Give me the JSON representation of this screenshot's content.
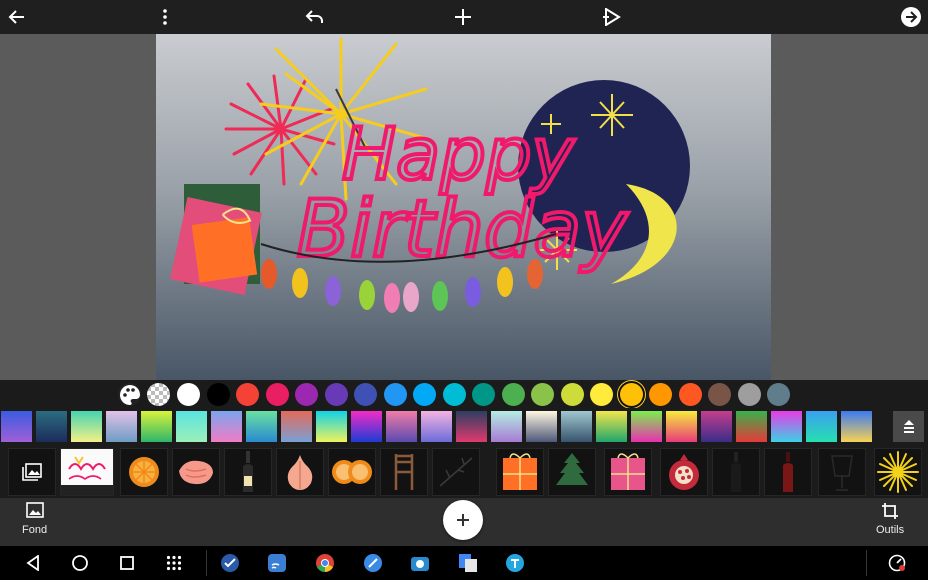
{
  "toolbar": {
    "back_icon": "arrow-left-icon",
    "menu_icon": "more-vertical-icon",
    "undo_icon": "undo-icon",
    "add_icon": "plus-icon",
    "preview_icon": "play-icon",
    "next_icon": "arrow-right-circle-icon"
  },
  "card": {
    "headline_line1": "Happy",
    "headline_line2": "Birthday",
    "accent_color": "#f0196b",
    "moon_color": "#1f2452"
  },
  "palette": {
    "colors": [
      "#ffffff",
      "#000000",
      "#f44336",
      "#e91e63",
      "#9c27b0",
      "#673ab7",
      "#3f51b5",
      "#2196f3",
      "#03a9f4",
      "#00bcd4",
      "#009688",
      "#4caf50",
      "#8bc34a",
      "#cddc39",
      "#ffeb3b",
      "#ffc107",
      "#ff9800",
      "#ff5722",
      "#795548",
      "#9e9e9e",
      "#607d8b"
    ],
    "selected": "#ffc107"
  },
  "bottom": {
    "background_label": "Fond",
    "tools_label": "Outils"
  },
  "systembar": {
    "back_icon": "nav-back-icon",
    "home_icon": "nav-home-icon",
    "recents_icon": "nav-recents-icon",
    "apps_icon": "app-drawer-icon"
  }
}
